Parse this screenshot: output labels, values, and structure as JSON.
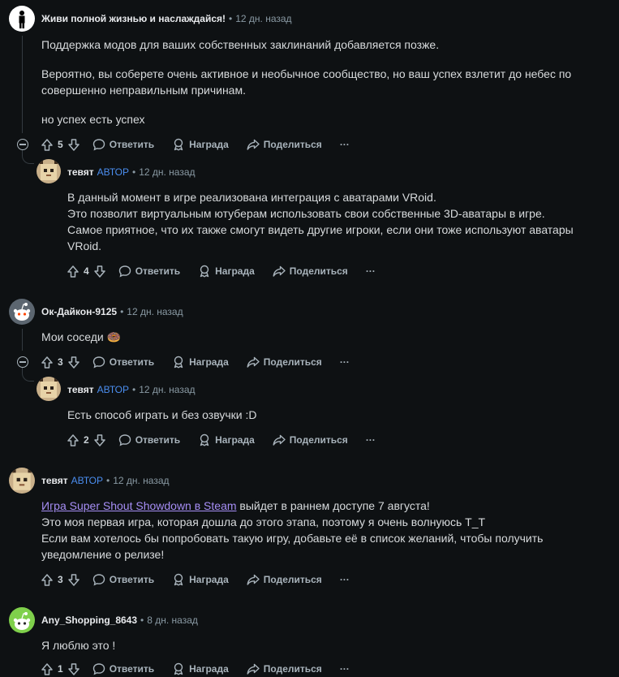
{
  "actions": {
    "reply": "Ответить",
    "award": "Награда",
    "share": "Поделиться",
    "more": "···"
  },
  "c1": {
    "user": "Живи полной жизнью и наслаждайся!",
    "time": "12 дн. назад",
    "lines": [
      "Поддержка модов для ваших собственных заклинаний добавляется позже.",
      "Вероятно, вы соберете очень активное и необычное сообщество, но ваш успех взлетит до небес по",
      "совершенно неправильным причинам.",
      "но успех есть успех"
    ],
    "votes": "5"
  },
  "r1": {
    "user": "тевят",
    "op": "АВТОР",
    "time": "12 дн. назад",
    "lines": [
      "В данный момент в игре реализована интеграция с аватарами VRoid.",
      "Это позволит виртуальным ютуберам использовать свои собственные 3D-аватары в игре.",
      "Самое приятное, что их также смогут видеть другие игроки, если они тоже используют аватары",
      "VRoid."
    ],
    "votes": "4"
  },
  "c2": {
    "user": "Ок-Дайкон-9125",
    "time": "12 дн. назад",
    "text": "Мои соседи",
    "emoji": "🍩",
    "votes": "3"
  },
  "r2": {
    "user": "тевят",
    "op": "АВТОР",
    "time": "12 дн. назад",
    "text": "Есть способ играть и без озвучки :D",
    "votes": "2"
  },
  "c3": {
    "user": "тевят",
    "op": "АВТОР",
    "time": "12 дн. назад",
    "link": "Игра Super Shout Showdown в Steam",
    "after_link": " выйдет в раннем доступе 7 августа!",
    "lines": [
      "Это моя первая игра, которая дошла до этого этапа, поэтому я очень волнуюсь T_T",
      "Если вам хотелось бы попробовать такую игру, добавьте её в список желаний, чтобы получить",
      "уведомление о релизе!"
    ],
    "votes": "3"
  },
  "c4": {
    "user": "Any_Shopping_8643",
    "time": "8 дн. назад",
    "text": "Я люблю это !",
    "votes": "1"
  },
  "colors": {
    "background": "#0e1113",
    "link": "#a68ef5",
    "op": "#4b8ef0"
  }
}
